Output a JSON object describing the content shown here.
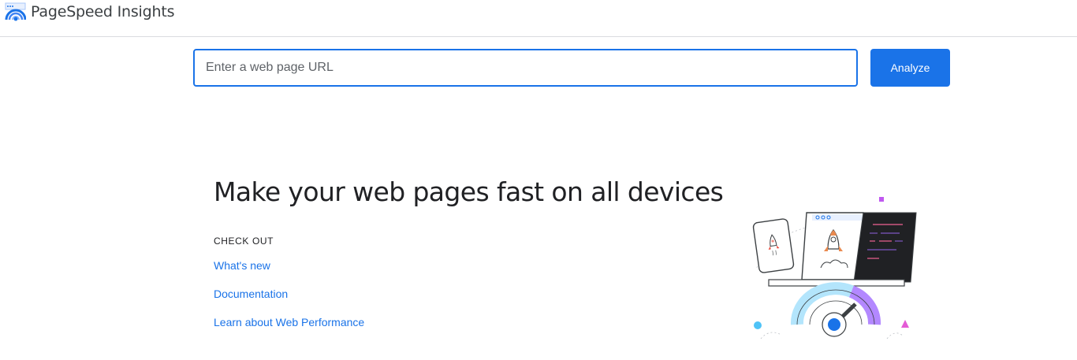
{
  "header": {
    "app_title": "PageSpeed Insights",
    "logo_icon": "pagespeed-gauge-icon"
  },
  "search": {
    "placeholder": "Enter a web page URL",
    "value": "",
    "analyze_label": "Analyze"
  },
  "hero": {
    "title": "Make your web pages fast on all devices",
    "check_out_label": "CHECK OUT",
    "links": [
      {
        "label": "What's new"
      },
      {
        "label": "Documentation"
      },
      {
        "label": "Learn about Web Performance"
      }
    ],
    "illustration": "devices-speed-gauge-illustration"
  },
  "colors": {
    "accent": "#1a73e8",
    "border": "#dadce0",
    "text": "#202124"
  }
}
